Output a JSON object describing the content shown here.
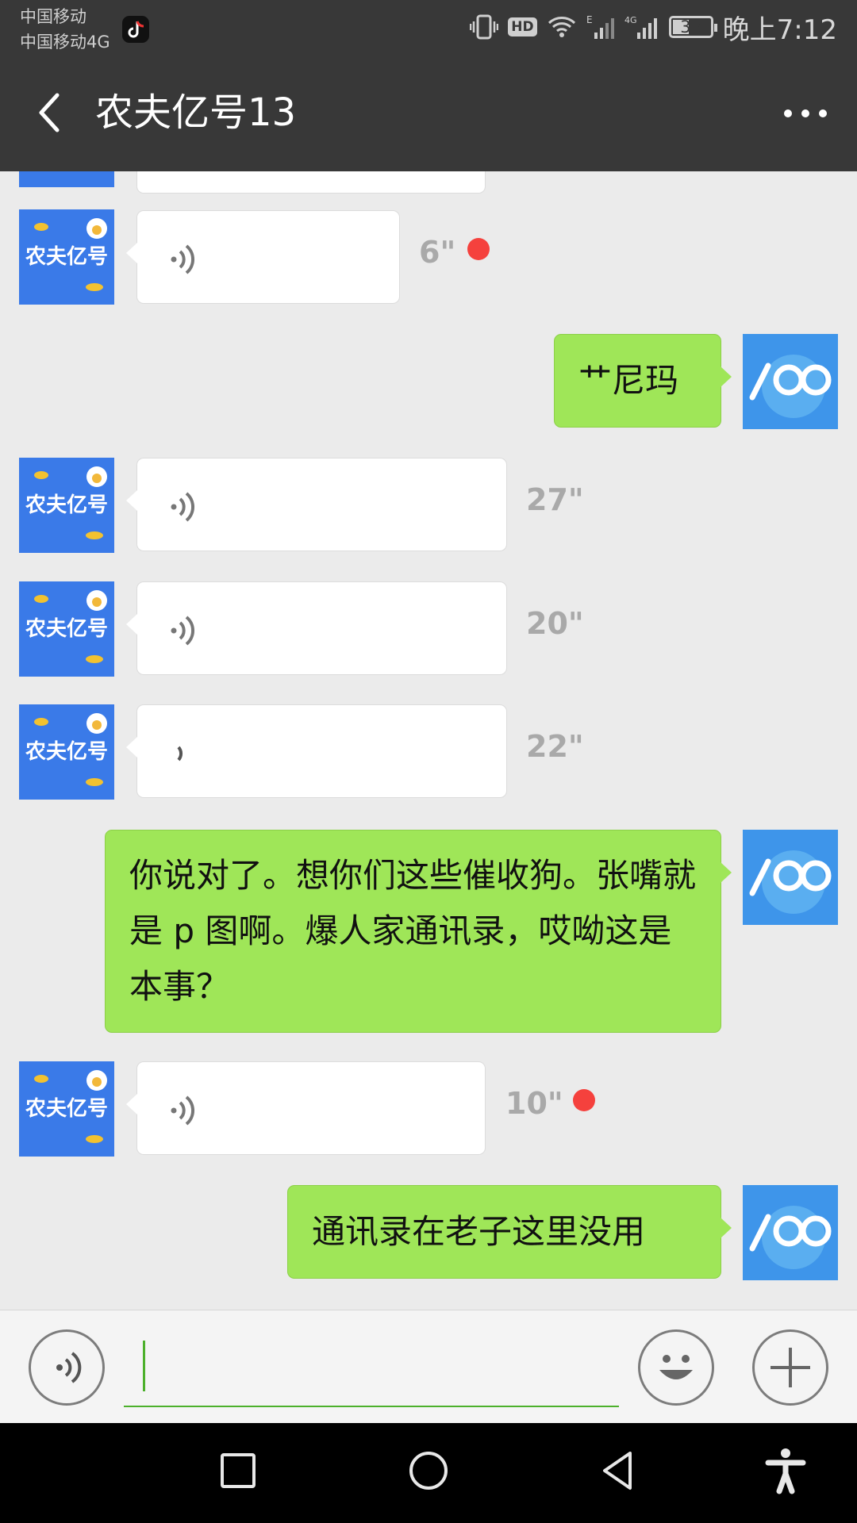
{
  "status_bar": {
    "carrier_1": "中国移动",
    "carrier_2": "中国移动4G",
    "hd": "HD",
    "battery": "33",
    "time": "晚上7:12"
  },
  "header": {
    "title": "农夫亿号13"
  },
  "messages": [
    {
      "side": "left",
      "type": "voice",
      "duration": "6\"",
      "unread": true
    },
    {
      "side": "right",
      "type": "text",
      "text": "艹尼玛"
    },
    {
      "side": "left",
      "type": "voice",
      "duration": "27\"",
      "unread": false
    },
    {
      "side": "left",
      "type": "voice",
      "duration": "20\"",
      "unread": false
    },
    {
      "side": "left",
      "type": "voice",
      "duration": "22\"",
      "unread": false
    },
    {
      "side": "right",
      "type": "text",
      "text": "你说对了。想你们这些催收狗。张嘴就是 p 图啊。爆人家通讯录，哎呦这是本事？"
    },
    {
      "side": "left",
      "type": "voice",
      "duration": "10\"",
      "unread": true
    },
    {
      "side": "right",
      "type": "text",
      "text": "通讯录在老子这里没用"
    }
  ],
  "colors": {
    "header_bg": "#383838",
    "chat_bg": "#ebebeb",
    "green_bubble": "#9fe658",
    "unread_dot": "#f5413d",
    "input_accent": "#4cb02b"
  },
  "icons": {
    "back": "chevron-left-icon",
    "more": "more-dots-icon",
    "voice": "voice-wave-icon",
    "emoji": "smiley-icon",
    "plus": "plus-icon"
  }
}
